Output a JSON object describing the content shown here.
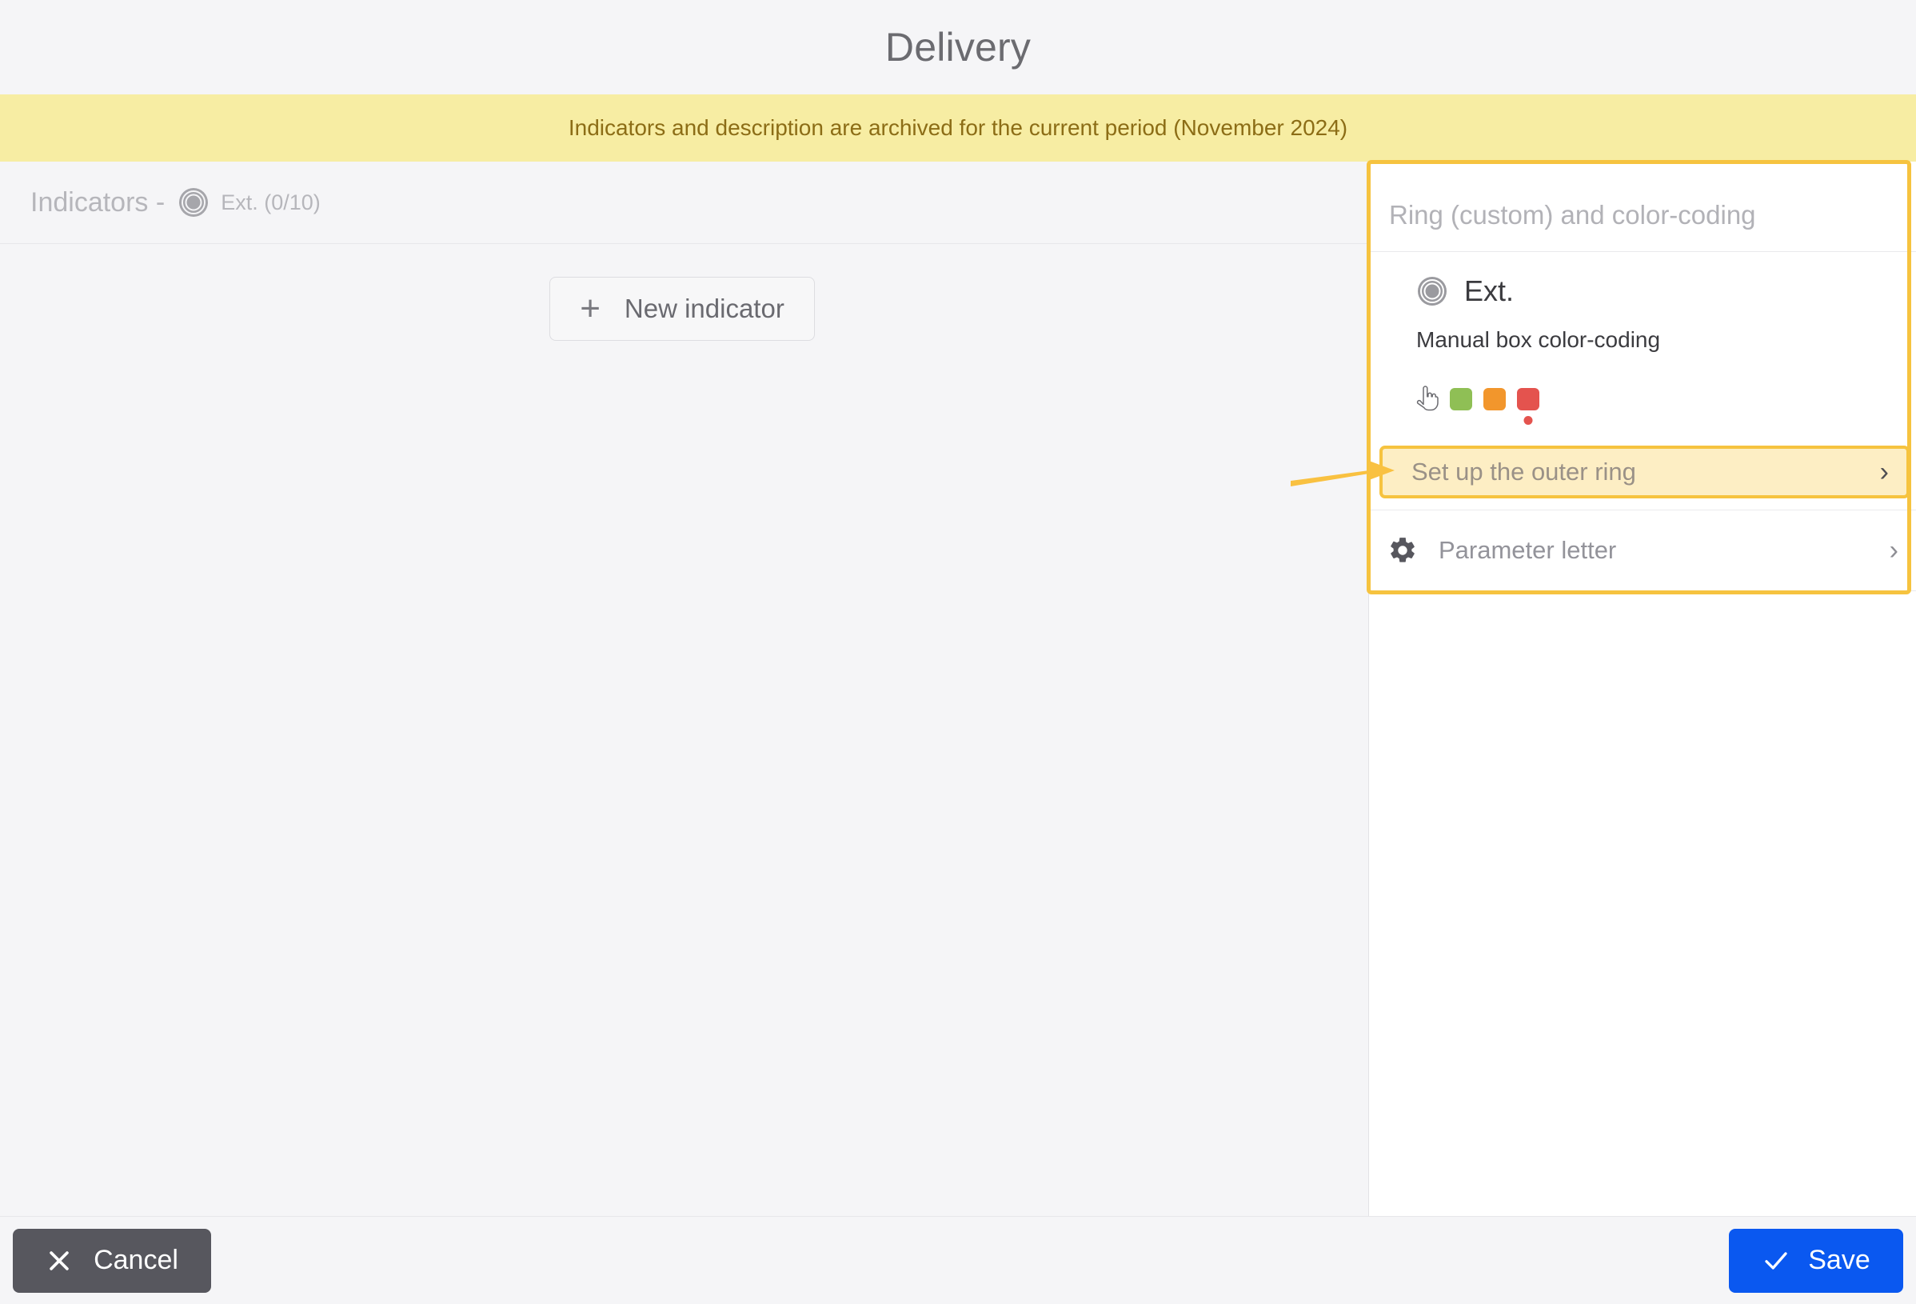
{
  "header": {
    "title": "Delivery"
  },
  "banner": {
    "text": "Indicators and description are archived for the current period (November 2024)",
    "bg_color": "#f7eda3",
    "text_color": "#8c6d16"
  },
  "main": {
    "indicators_label": "Indicators -",
    "indicators_count": "Ext. (0/10)",
    "ring_icon": "target-ring-icon",
    "new_indicator_button": {
      "label": "New indicator",
      "icon": "plus-icon"
    }
  },
  "side_panel": {
    "title": "Ring (custom) and color-coding",
    "highlight_color": "#f6c33f",
    "ext_item": {
      "label": "Ext.",
      "icon": "target-ring-icon"
    },
    "manual_coding_label": "Manual box color-coding",
    "swatches": [
      {
        "name": "pointer-hand-icon",
        "type": "icon",
        "color": "#6b6b70",
        "selected": false
      },
      {
        "name": "swatch-green",
        "type": "color",
        "color": "#8fbf55",
        "selected": false
      },
      {
        "name": "swatch-orange",
        "type": "color",
        "color": "#f2962c",
        "selected": false
      },
      {
        "name": "swatch-red",
        "type": "color",
        "color": "#e4534e",
        "selected": true
      }
    ],
    "outer_ring_row": {
      "label": "Set up the outer ring",
      "chevron": "chevron-right-icon",
      "bg_color": "#fdeec4",
      "border_color": "#f6c33f"
    },
    "parameter_row": {
      "label": "Parameter letter",
      "icon": "gear-icon",
      "chevron": "chevron-right-icon"
    }
  },
  "annotation": {
    "arrow": "arrow-right-annotation",
    "color": "#f9c141"
  },
  "footer": {
    "cancel": {
      "label": "Cancel",
      "icon": "close-icon",
      "bg_color": "#57575e"
    },
    "save": {
      "label": "Save",
      "icon": "check-icon",
      "bg_color": "#0a58f0"
    }
  }
}
